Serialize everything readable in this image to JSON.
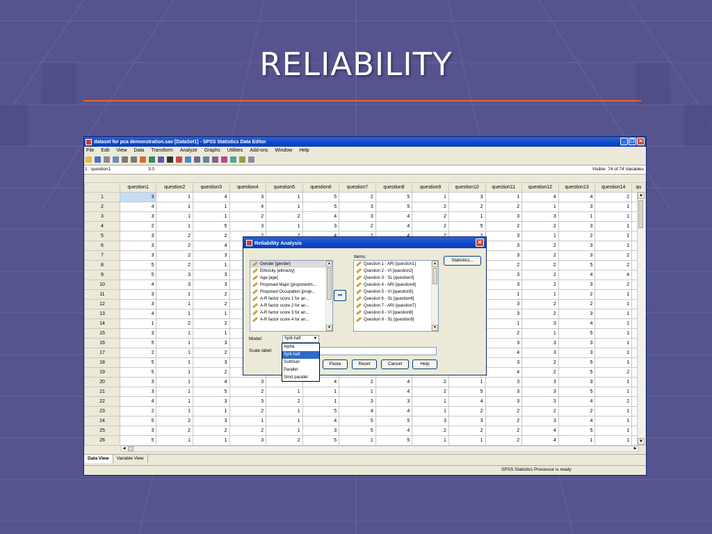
{
  "slide": {
    "title": "RELIABILITY"
  },
  "window": {
    "title": "dataset for pca demonstration.sav [DataSet1] - SPSS Statistics Data Editor",
    "menu": [
      "File",
      "Edit",
      "View",
      "Data",
      "Transform",
      "Analyze",
      "Graphs",
      "Utilities",
      "Add-ons",
      "Window",
      "Help"
    ],
    "cell_ref": "1 : question1",
    "cell_value": "3.0",
    "visible_text": "Visible: 74 of 74 Variables",
    "columns": [
      "question1",
      "question2",
      "question3",
      "question4",
      "question5",
      "question6",
      "question7",
      "question8",
      "question9",
      "question10",
      "question11",
      "question12",
      "question13",
      "question14",
      "qu"
    ],
    "rows": [
      [
        "1",
        "3",
        "1",
        "4",
        "3",
        "1",
        "5",
        "2",
        "5",
        "1",
        "3",
        "1",
        "4",
        "4",
        "2"
      ],
      [
        "2",
        "4",
        "1",
        "1",
        "4",
        "1",
        "5",
        "3",
        "5",
        "2",
        "2",
        "2",
        "1",
        "3",
        "1"
      ],
      [
        "3",
        "3",
        "1",
        "1",
        "2",
        "2",
        "4",
        "3",
        "4",
        "2",
        "1",
        "3",
        "3",
        "1",
        "1"
      ],
      [
        "4",
        "2",
        "1",
        "5",
        "3",
        "1",
        "3",
        "2",
        "4",
        "2",
        "5",
        "2",
        "2",
        "3",
        "1"
      ],
      [
        "5",
        "3",
        "2",
        "2",
        "2",
        "2",
        "4",
        "2",
        "4",
        "2",
        "2",
        "3",
        "1",
        "2",
        "1"
      ],
      [
        "6",
        "3",
        "2",
        "4",
        "",
        "",
        "",
        "",
        "",
        "",
        "",
        "3",
        "2",
        "3",
        "1"
      ],
      [
        "7",
        "3",
        "2",
        "3",
        "",
        "",
        "",
        "",
        "",
        "",
        "",
        "3",
        "2",
        "3",
        "2"
      ],
      [
        "8",
        "5",
        "2",
        "1",
        "",
        "",
        "",
        "",
        "",
        "",
        "",
        "2",
        "2",
        "5",
        "2"
      ],
      [
        "9",
        "5",
        "3",
        "3",
        "",
        "",
        "",
        "",
        "",
        "",
        "",
        "3",
        "2",
        "4",
        "4"
      ],
      [
        "10",
        "4",
        "3",
        "3",
        "",
        "",
        "",
        "",
        "",
        "",
        "",
        "3",
        "2",
        "3",
        "2"
      ],
      [
        "11",
        "3",
        "1",
        "2",
        "",
        "",
        "",
        "",
        "",
        "",
        "",
        "1",
        "1",
        "2",
        "1"
      ],
      [
        "12",
        "3",
        "1",
        "2",
        "",
        "",
        "",
        "",
        "",
        "",
        "",
        "3",
        "2",
        "2",
        "1"
      ],
      [
        "13",
        "4",
        "1",
        "1",
        "",
        "",
        "",
        "",
        "",
        "",
        "",
        "3",
        "2",
        "3",
        "1"
      ],
      [
        "14",
        "1",
        "2",
        "2",
        "",
        "",
        "",
        "",
        "",
        "",
        "",
        "1",
        "3",
        "4",
        "1"
      ],
      [
        "15",
        "3",
        "1",
        "1",
        "",
        "",
        "",
        "",
        "",
        "",
        "",
        "2",
        "1",
        "5",
        "1"
      ],
      [
        "16",
        "5",
        "1",
        "3",
        "",
        "",
        "",
        "",
        "",
        "",
        "",
        "3",
        "3",
        "3",
        "1"
      ],
      [
        "17",
        "2",
        "1",
        "2",
        "",
        "",
        "",
        "",
        "",
        "",
        "",
        "4",
        "3",
        "3",
        "1"
      ],
      [
        "18",
        "5",
        "1",
        "3",
        "",
        "",
        "",
        "",
        "",
        "",
        "",
        "3",
        "2",
        "5",
        "1"
      ],
      [
        "19",
        "5",
        "1",
        "2",
        "",
        "",
        "",
        "",
        "",
        "",
        "",
        "4",
        "2",
        "5",
        "2"
      ],
      [
        "20",
        "3",
        "1",
        "4",
        "3",
        "",
        "4",
        "2",
        "4",
        "2",
        "1",
        "3",
        "3",
        "3",
        "1"
      ],
      [
        "21",
        "3",
        "1",
        "5",
        "2",
        "1",
        "1",
        "1",
        "4",
        "2",
        "5",
        "3",
        "3",
        "5",
        "1"
      ],
      [
        "22",
        "4",
        "1",
        "3",
        "3",
        "2",
        "1",
        "3",
        "3",
        "1",
        "4",
        "3",
        "3",
        "4",
        "2"
      ],
      [
        "23",
        "2",
        "1",
        "1",
        "2",
        "1",
        "5",
        "4",
        "4",
        "1",
        "2",
        "2",
        "2",
        "2",
        "1"
      ],
      [
        "24",
        "5",
        "2",
        "3",
        "1",
        "1",
        "4",
        "5",
        "5",
        "3",
        "3",
        "2",
        "3",
        "4",
        "1"
      ],
      [
        "25",
        "3",
        "2",
        "2",
        "2",
        "1",
        "3",
        "5",
        "4",
        "2",
        "2",
        "2",
        "4",
        "5",
        "1"
      ],
      [
        "26",
        "5",
        "1",
        "1",
        "3",
        "2",
        "5",
        "1",
        "5",
        "1",
        "1",
        "2",
        "4",
        "1",
        "1"
      ]
    ],
    "tabs": [
      "Data View",
      "Variable View"
    ],
    "status": "SPSS Statistics  Processor is ready"
  },
  "dialog": {
    "title": "Reliability Analysis",
    "items_label": "Items:",
    "left_list": [
      "Gender [gender]",
      "Ethnicity [ethnicity]",
      "Age [age]",
      "Proposed Major [proposedm...",
      "Proposed Occupation [proje...",
      "A-R  factor score  1 for an...",
      "A-R  factor score  2 for an...",
      "A-R  factor score  3 for an...",
      "A-R  factor score  4 for an..."
    ],
    "right_list": [
      "Question 1 - ARI [question1]",
      "Question 2 - VI [question2]",
      "Question 3 - SL [question3]",
      "Question 4 - ARI [question4]",
      "Question 5 - VI [question5]",
      "Question 6 - SL [question6]",
      "Question 7 - ARI [question7]",
      "Question 8 - VI [question8]",
      "Question 9 - SL [question9]"
    ],
    "statistics_label": "Statistics...",
    "model_label": "Model:",
    "model_value": "Split-half",
    "scale_label": "Scale label:",
    "model_options": [
      "Alpha",
      "Split-half",
      "Guttman",
      "Parallel",
      "Strict parallel"
    ],
    "buttons": [
      "Paste",
      "Reset",
      "Cancel",
      "Help"
    ]
  },
  "colors": {
    "slide_bg": "#55548f",
    "title_rule": "#e8622a",
    "title_bar": "#0b48c8"
  }
}
